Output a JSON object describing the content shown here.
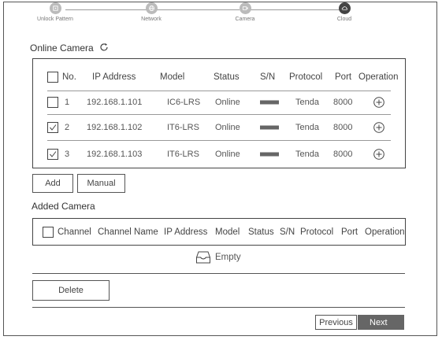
{
  "steps": [
    {
      "label": "Unlock Pattern",
      "icon": "lock-pattern-icon",
      "active": false
    },
    {
      "label": "Network",
      "icon": "network-globe-icon",
      "active": false
    },
    {
      "label": "Camera",
      "icon": "camera-icon",
      "active": false
    },
    {
      "label": "Cloud",
      "icon": "cloud-icon",
      "active": true
    }
  ],
  "online": {
    "title": "Online Camera",
    "columns": [
      "No.",
      "IP Address",
      "Model",
      "Status",
      "S/N",
      "Protocol",
      "Port",
      "Operation"
    ],
    "rows": [
      {
        "no": "1",
        "ip": "192.168.1.101",
        "model": "IC6-LRS",
        "status": "Online",
        "protocol": "Tenda",
        "port": "8000",
        "checked": false
      },
      {
        "no": "2",
        "ip": "192.168.1.102",
        "model": "IT6-LRS",
        "status": "Online",
        "protocol": "Tenda",
        "port": "8000",
        "checked": true
      },
      {
        "no": "3",
        "ip": "192.168.1.103",
        "model": "IT6-LRS",
        "status": "Online",
        "protocol": "Tenda",
        "port": "8000",
        "checked": true
      }
    ]
  },
  "buttons": {
    "add": "Add",
    "manual": "Manual",
    "delete": "Delete",
    "previous": "Previous",
    "next": "Next"
  },
  "added": {
    "title": "Added Camera",
    "columns": [
      "Channel",
      "Channel Name",
      "IP Address",
      "Model",
      "Status",
      "S/N",
      "Protocol",
      "Port",
      "Operation"
    ],
    "empty_label": "Empty"
  },
  "colors": {
    "border": "#444444",
    "next_bg": "#666666",
    "active_step": "#444444",
    "inactive_step": "#bbbbbb"
  }
}
